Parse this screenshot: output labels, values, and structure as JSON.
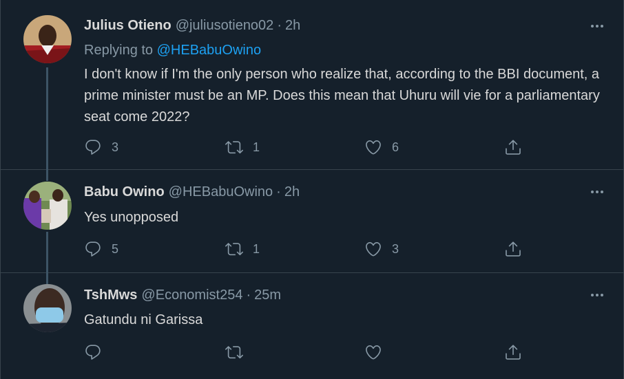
{
  "tweets": [
    {
      "name": "Julius Otieno",
      "handle": "@juliusotieno02",
      "separator": "·",
      "time": "2h",
      "replying_label": "Replying to",
      "replying_to": "@HEBabuOwino",
      "text": "I don't know if I'm the only person who realize that, according to the BBI document, a prime minister must be an MP. Does this mean that Uhuru will vie for a parliamentary seat come 2022?",
      "replies": "3",
      "retweets": "1",
      "likes": "6"
    },
    {
      "name": "Babu Owino",
      "handle": "@HEBabuOwino",
      "separator": "·",
      "time": "2h",
      "text": "Yes unopposed",
      "replies": "5",
      "retweets": "1",
      "likes": "3"
    },
    {
      "name": "TshMws",
      "handle": "@Economist254",
      "separator": "·",
      "time": "25m",
      "text": "Gatundu ni Garissa",
      "replies": "",
      "retweets": "",
      "likes": ""
    }
  ],
  "icons": {
    "reply": "reply-icon",
    "retweet": "retweet-icon",
    "like": "like-icon",
    "share": "share-icon",
    "more": "more-icon"
  },
  "colors": {
    "background": "#15202b",
    "text": "#d9d9d9",
    "secondary": "#8899a6",
    "link": "#1da1f2",
    "border": "#38444d"
  }
}
